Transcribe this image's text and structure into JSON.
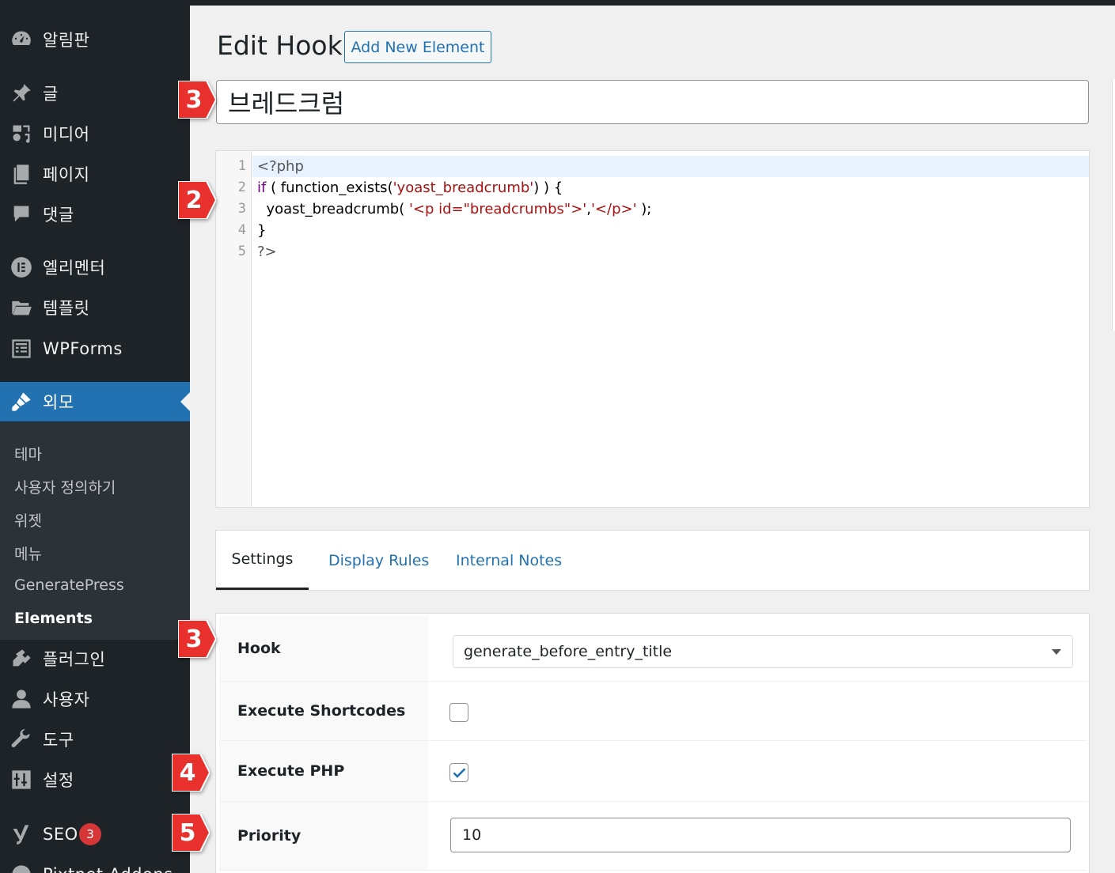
{
  "sidebar": {
    "items": [
      {
        "label": "알림판",
        "icon": "dashboard-icon"
      },
      {
        "label": "글",
        "icon": "pin-icon"
      },
      {
        "label": "미디어",
        "icon": "media-icon"
      },
      {
        "label": "페이지",
        "icon": "pages-icon"
      },
      {
        "label": "댓글",
        "icon": "comments-icon"
      },
      {
        "label": "엘리멘터",
        "icon": "elementor-icon"
      },
      {
        "label": "템플릿",
        "icon": "folder-icon"
      },
      {
        "label": "WPForms",
        "icon": "forms-icon"
      },
      {
        "label": "외모",
        "icon": "brush-icon"
      },
      {
        "label": "플러그인",
        "icon": "plugin-icon"
      },
      {
        "label": "사용자",
        "icon": "user-icon"
      },
      {
        "label": "도구",
        "icon": "wrench-icon"
      },
      {
        "label": "설정",
        "icon": "settings-icon"
      },
      {
        "label": "SEO",
        "icon": "yoast-icon",
        "badge": "3"
      },
      {
        "label": "Pixtnet Addons",
        "icon": "addons-icon"
      }
    ],
    "submenu": [
      "테마",
      "사용자 정의하기",
      "위젯",
      "메뉴",
      "GeneratePress",
      "Elements"
    ]
  },
  "header": {
    "title": "Edit Hook",
    "add_new_label": "Add New Element"
  },
  "post_title": "브레드크럼",
  "code": {
    "line_numbers": [
      "1",
      "2",
      "3",
      "4",
      "5"
    ],
    "lines": [
      {
        "parts": [
          {
            "t": "<?php",
            "c": "meta"
          }
        ]
      },
      {
        "parts": [
          {
            "t": "if",
            "c": "kw"
          },
          {
            "t": " ( function_exists(",
            "c": ""
          },
          {
            "t": "'yoast_breadcrumb'",
            "c": "str"
          },
          {
            "t": ") ) {",
            "c": ""
          }
        ]
      },
      {
        "parts": [
          {
            "t": "  yoast_breadcrumb( ",
            "c": ""
          },
          {
            "t": "'<p id=\"breadcrumbs\">'",
            "c": "str"
          },
          {
            "t": ",",
            "c": ""
          },
          {
            "t": "'</p>'",
            "c": "str"
          },
          {
            "t": " );",
            "c": ""
          }
        ]
      },
      {
        "parts": [
          {
            "t": "}",
            "c": ""
          }
        ]
      },
      {
        "parts": [
          {
            "t": "?>",
            "c": "meta"
          }
        ]
      }
    ]
  },
  "tabs": [
    "Settings",
    "Display Rules",
    "Internal Notes"
  ],
  "settings": {
    "hook_label": "Hook",
    "hook_value": "generate_before_entry_title",
    "shortcodes_label": "Execute Shortcodes",
    "shortcodes_checked": false,
    "php_label": "Execute PHP",
    "php_checked": true,
    "priority_label": "Priority",
    "priority_value": "10"
  },
  "markers": [
    "3",
    "2",
    "3",
    "4",
    "5"
  ],
  "colors": {
    "sidebar": "#1d2327",
    "accent": "#2271b1",
    "marker": "#e8312c",
    "badge": "#d63638"
  }
}
